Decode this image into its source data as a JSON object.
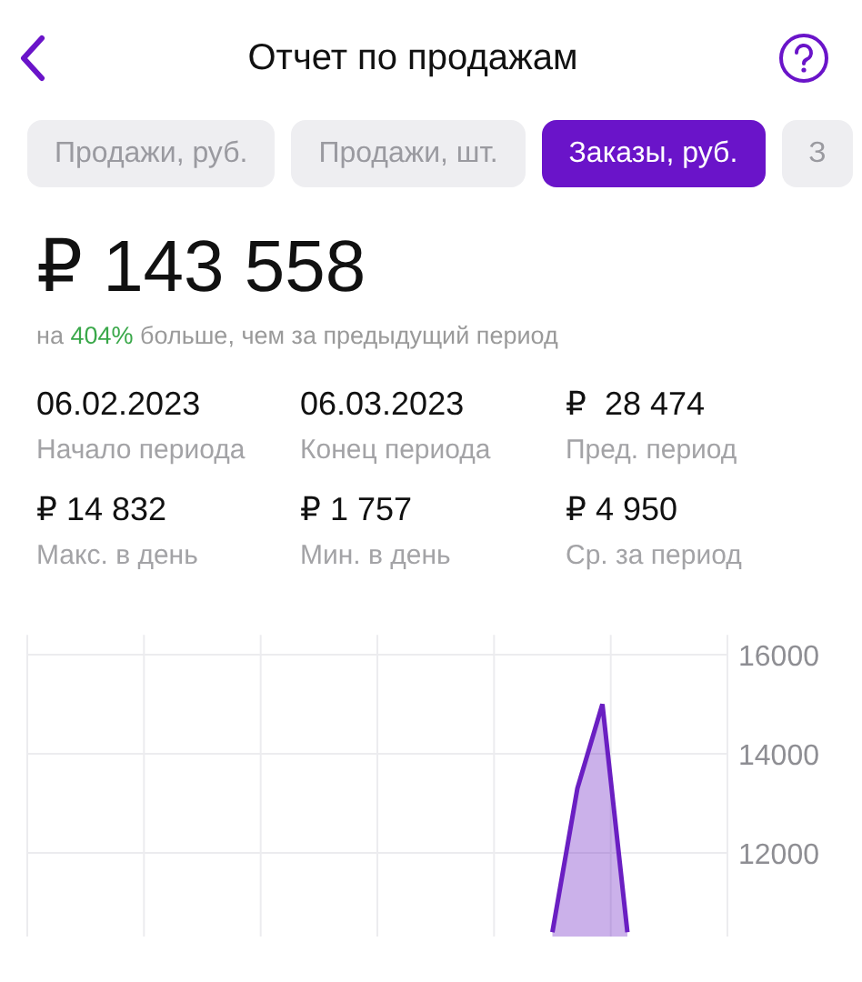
{
  "header": {
    "title": "Отчет по продажам"
  },
  "tabs": [
    {
      "label": "Продажи, руб.",
      "selected": false
    },
    {
      "label": "Продажи, шт.",
      "selected": false
    },
    {
      "label": "Заказы, руб.",
      "selected": true
    },
    {
      "label": "З",
      "selected": false
    }
  ],
  "total": {
    "value": "₽ 143 558",
    "comparison": "на **404%** больше, чем за предыдущий период"
  },
  "stats": [
    {
      "value": "06.02.2023",
      "label": "Начало периода"
    },
    {
      "value": "06.03.2023",
      "label": "Конец периода"
    },
    {
      "value": "₽  28 474",
      "label": "Пред. период"
    },
    {
      "value": "₽ 14 832",
      "label": "Макс. в день"
    },
    {
      "value": "₽ 1 757",
      "label": "Мин. в день"
    },
    {
      "value": "₽ 4 950",
      "label": "Ср. за период"
    }
  ],
  "chart": {
    "chart_data": {
      "type": "area",
      "categories": [
        null,
        null,
        null,
        null,
        null,
        null,
        null,
        null,
        null,
        null,
        null,
        null,
        null,
        null,
        null,
        null,
        null,
        null,
        null,
        null,
        null,
        null,
        null,
        null,
        null,
        null,
        null,
        null,
        null
      ],
      "ylim": [
        10300,
        16400
      ],
      "grid": true,
      "yticks": [
        12000,
        14000,
        16000
      ],
      "series": [
        {
          "color": "#6a1fc2",
          "values": [
            null,
            null,
            null,
            null,
            null,
            null,
            null,
            null,
            null,
            null,
            null,
            null,
            null,
            null,
            null,
            null,
            null,
            null,
            null,
            null,
            null,
            10400,
            13300,
            15000,
            10400,
            null,
            null,
            null,
            null
          ]
        }
      ]
    }
  }
}
